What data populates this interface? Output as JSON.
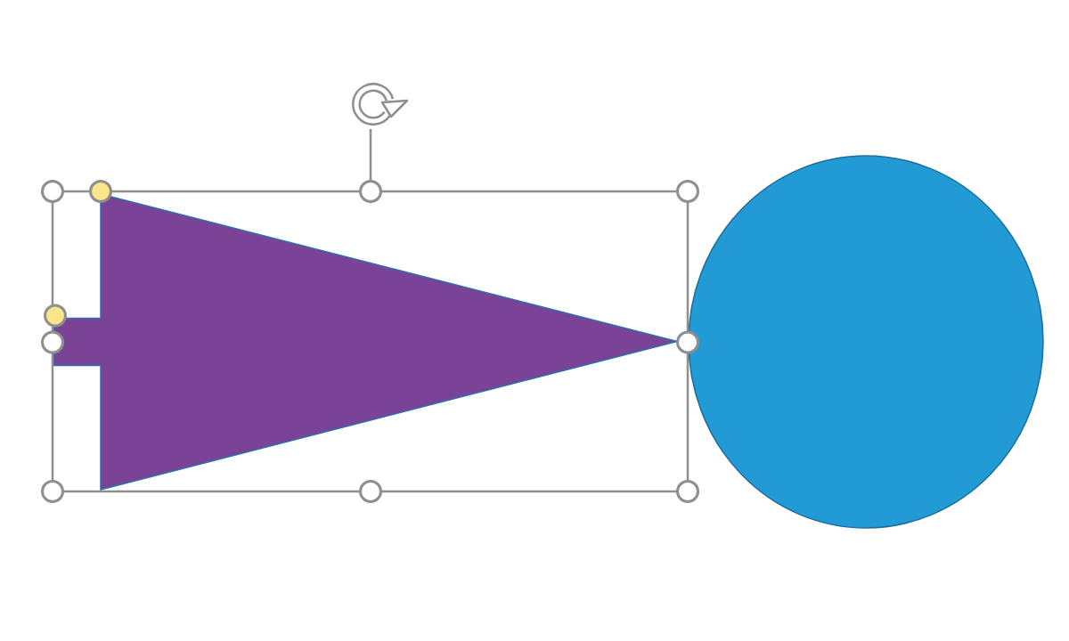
{
  "canvas": {
    "shapes": [
      {
        "kind": "arrow",
        "color": "#7b4397",
        "selected": true
      },
      {
        "kind": "circle",
        "color": "#229ad6",
        "selected": false
      }
    ]
  }
}
